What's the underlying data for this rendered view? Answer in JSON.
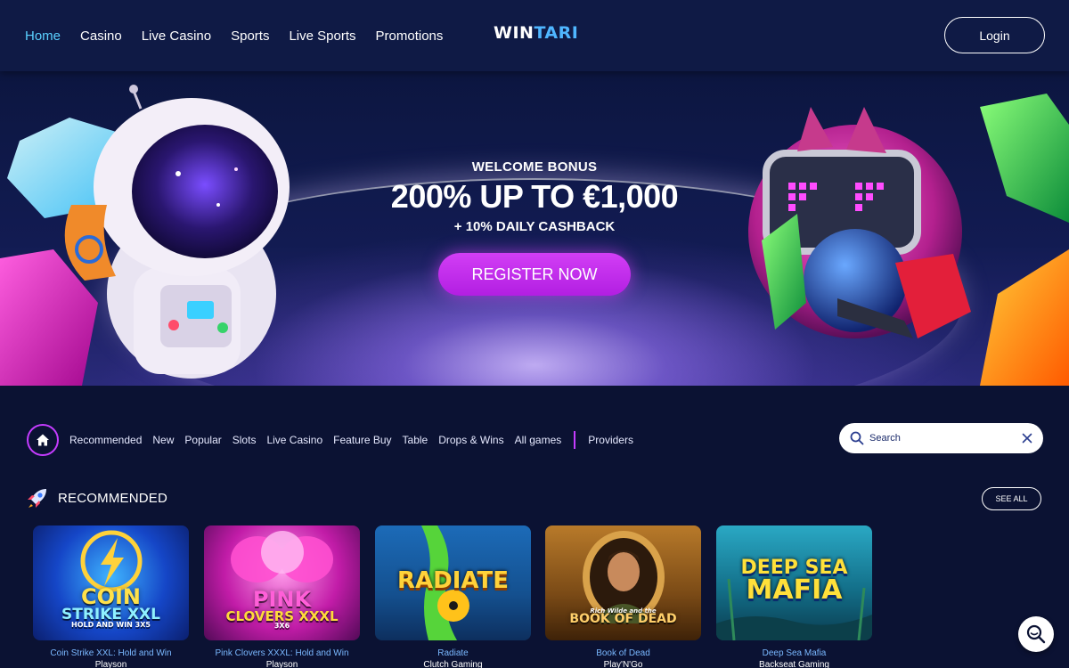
{
  "header": {
    "nav": [
      "Home",
      "Casino",
      "Live Casino",
      "Sports",
      "Live Sports",
      "Promotions"
    ],
    "logo_main": "WIN",
    "logo_accent": "TARI",
    "login_label": "Login"
  },
  "hero": {
    "welcome": "WELCOME BONUS",
    "headline": "200% UP TO €1,000",
    "cashback": "+ 10% DAILY CASHBACK",
    "register_label": "REGISTER NOW"
  },
  "categories": {
    "items": [
      "Recommended",
      "New",
      "Popular",
      "Slots",
      "Live Casino",
      "Feature Buy",
      "Table",
      "Drops & Wins",
      "All games"
    ],
    "providers_label": "Providers"
  },
  "search": {
    "placeholder": "Search"
  },
  "recommended": {
    "title": "RECOMMENDED",
    "see_all_label": "SEE ALL",
    "games": [
      {
        "name": "Coin Strike XXL: Hold and Win",
        "provider": "Playson",
        "art_top": "COIN",
        "art_mid": "STRIKE XXL",
        "art_bottom": "HOLD AND WIN 3X5"
      },
      {
        "name": "Pink Clovers XXXL: Hold and Win",
        "provider": "Playson",
        "art_top": "PINK",
        "art_mid": "CLOVERS XXXL",
        "art_bottom": "3X6"
      },
      {
        "name": "Radiate",
        "provider": "Clutch Gaming",
        "art_top": "RADIATE",
        "art_mid": "",
        "art_bottom": ""
      },
      {
        "name": "Book of Dead",
        "provider": "Play'N'Go",
        "art_top": "Rich Wilde and the",
        "art_mid": "BOOK OF DEAD",
        "art_bottom": ""
      },
      {
        "name": "Deep Sea Mafia",
        "provider": "Backseat Gaming",
        "art_top": "DEEP SEA",
        "art_mid": "MAFIA",
        "art_bottom": ""
      }
    ]
  },
  "colors": {
    "background": "#0b1233",
    "header": "#0f1a45",
    "accent_purple": "#c53cff",
    "nav_active": "#5ad0ff",
    "game_name": "#7ab8ff"
  },
  "icons": {
    "home": "home-icon",
    "search": "search-icon",
    "clear": "close-icon",
    "section": "rocket-icon",
    "chat": "chat-search-icon"
  }
}
